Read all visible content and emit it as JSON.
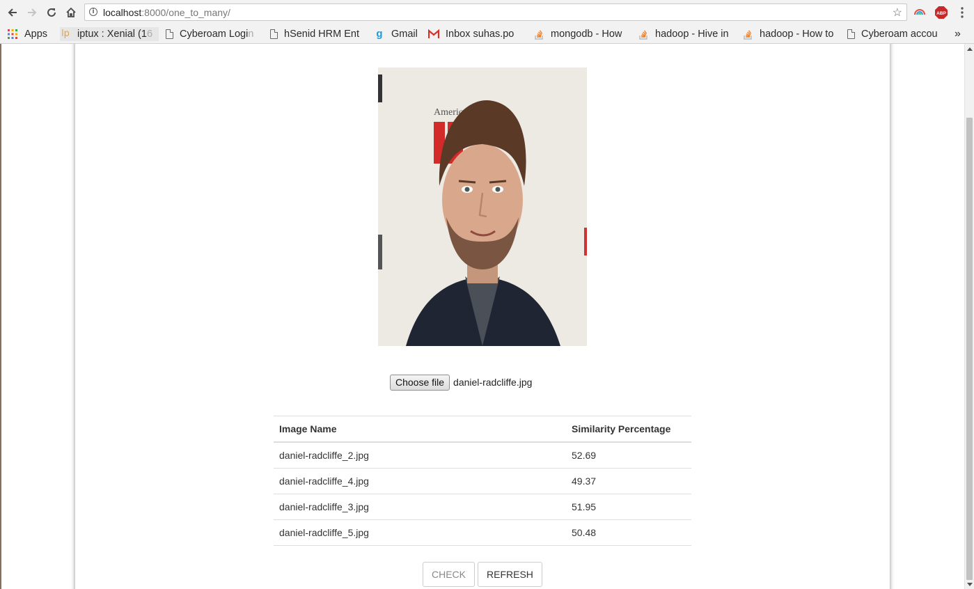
{
  "browser": {
    "url_host": "localhost",
    "url_rest": ":8000/one_to_many/",
    "bookmarks": [
      {
        "label": "Apps",
        "icon": "apps-grid-icon"
      },
      {
        "label": "iptux : Xenial (1",
        "fade": "6",
        "icon": "lp-icon"
      },
      {
        "label": "Cyberoam Logi",
        "fade": "n",
        "icon": "page-icon"
      },
      {
        "label": "hSenid HRM Ent",
        "fade": "",
        "icon": "page-icon"
      },
      {
        "label": "Gmail",
        "fade": "",
        "icon": "g-icon"
      },
      {
        "label": "Inbox  suhas.po",
        "fade": "",
        "icon": "gmail-icon"
      },
      {
        "label": "mongodb - How",
        "fade": "",
        "icon": "stackoverflow-icon"
      },
      {
        "label": "hadoop - Hive in",
        "fade": "",
        "icon": "stackoverflow-icon"
      },
      {
        "label": "hadoop - How to",
        "fade": "",
        "icon": "stackoverflow-icon"
      },
      {
        "label": "Cyberoam accou",
        "fade": "",
        "icon": "page-icon"
      }
    ],
    "overflow_label": "»",
    "extensions": {
      "abp_label": "ABP"
    },
    "colors": {
      "abp": "#c7292a",
      "so": "#f48024",
      "gmail": "#d93025"
    }
  },
  "page": {
    "choose_file_label": "Choose file",
    "file_name": "daniel-radcliffe.jpg",
    "table": {
      "headers": [
        "Image Name",
        "Similarity Percentage"
      ],
      "rows": [
        [
          "daniel-radcliffe_2.jpg",
          "52.69"
        ],
        [
          "daniel-radcliffe_4.jpg",
          "49.37"
        ],
        [
          "daniel-radcliffe_3.jpg",
          "51.95"
        ],
        [
          "daniel-radcliffe_5.jpg",
          "50.48"
        ]
      ]
    },
    "check_label": "CHECK",
    "refresh_label": "REFRESH"
  }
}
